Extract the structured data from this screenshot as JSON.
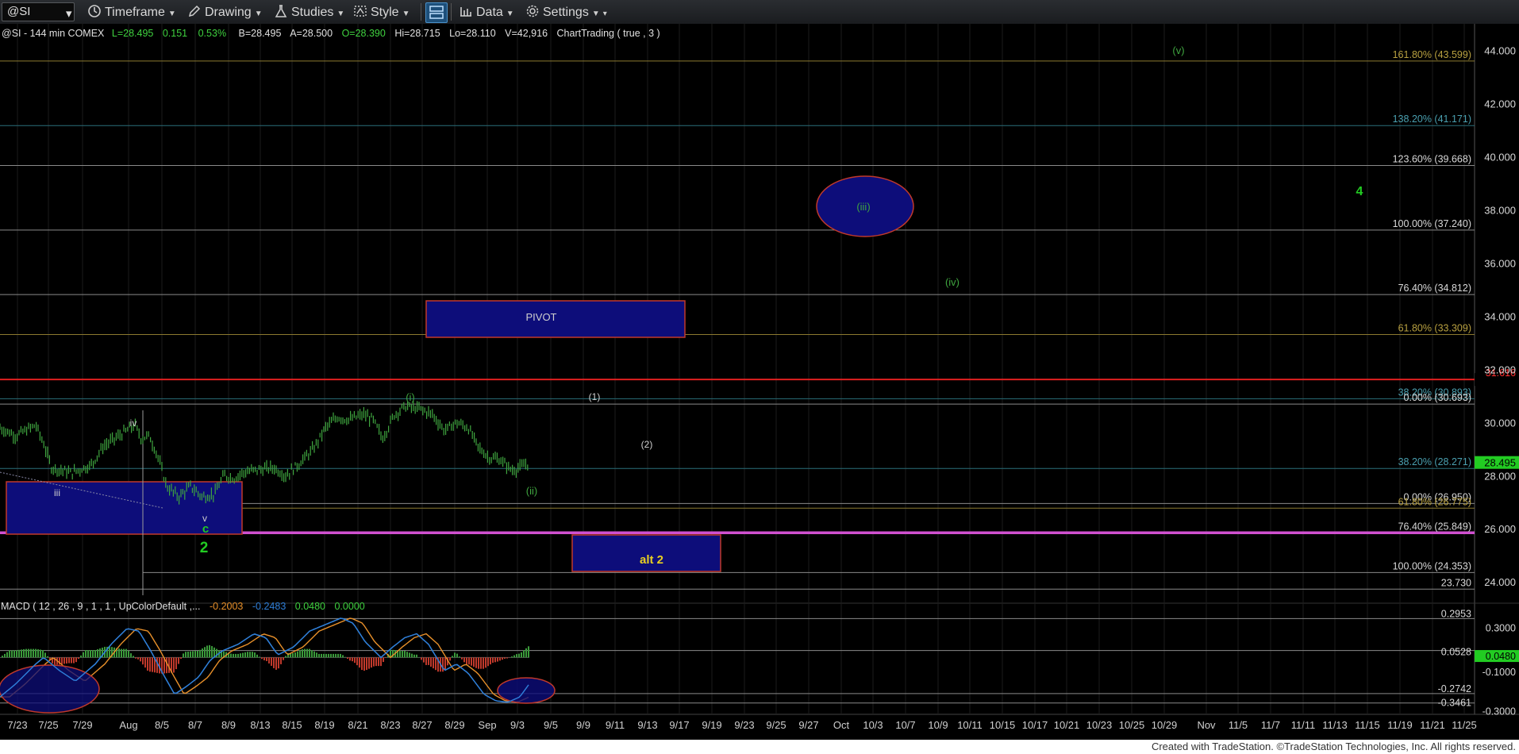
{
  "toolbar": {
    "symbol": "@SI",
    "timeframe": "Timeframe",
    "drawing": "Drawing",
    "studies": "Studies",
    "style": "Style",
    "data": "Data",
    "settings": "Settings"
  },
  "header": {
    "label": "@SI - 144 min  COMEX",
    "last": "L=28.495",
    "chg": "0.151",
    "pct": "0.53%",
    "bid": "B=28.495",
    "ask": "A=28.500",
    "open": "O=28.390",
    "hi": "Hi=28.715",
    "lo": "Lo=28.110",
    "vol": "V=42,916",
    "study": "ChartTrading ( true , 3 )"
  },
  "macd": {
    "label": "MACD ( 12 , 26 , 9 , 1 , 1 , UpColorDefault ,...",
    "v1": "-0.2003",
    "v2": "-0.2483",
    "v3": "0.0480",
    "v4": "0.0000"
  },
  "footer": "Created with TradeStation. ©TradeStation Technologies, Inc. All rights reserved.",
  "colors": {
    "price": "#3fa53f",
    "up": "#3a9a3a",
    "down": "#c0392b",
    "box": "#0d0d7a",
    "box_border": "#c0392b",
    "magenta": "#d050d0",
    "red_line": "#e02020",
    "macd_line": "#2f7fd8",
    "signal_line": "#e8902a"
  },
  "chart_data": {
    "type": "line",
    "series": [],
    "ylim": [
      23.2,
      45.0
    ],
    "yticks": [
      "44.000",
      "42.000",
      "40.000",
      "38.000",
      "36.000",
      "34.000",
      "32.000",
      "30.000",
      "28.000",
      "26.000",
      "24.000"
    ],
    "xticks": [
      "7/23",
      "7/25",
      "7/29",
      "Aug",
      "8/5",
      "8/7",
      "8/9",
      "8/13",
      "8/15",
      "8/19",
      "8/21",
      "8/23",
      "8/27",
      "8/29",
      "Sep",
      "9/3",
      "9/5",
      "9/9",
      "9/11",
      "9/13",
      "9/17",
      "9/19",
      "9/23",
      "9/25",
      "9/27",
      "Oct",
      "10/3",
      "10/7",
      "10/9",
      "10/11",
      "10/15",
      "10/17",
      "10/21",
      "10/23",
      "10/25",
      "10/29",
      "Nov",
      "11/5",
      "11/7",
      "11/11",
      "11/13",
      "11/15",
      "11/19",
      "11/21",
      "11/25"
    ],
    "last_price": "28.495",
    "fib_levels": [
      {
        "label": "161.80% (43.599)",
        "value": 43.599,
        "color": "#8c7a30"
      },
      {
        "label": "138.20% (41.171)",
        "value": 41.171,
        "color": "#2a6f7a"
      },
      {
        "label": "123.60% (39.668)",
        "value": 39.668,
        "color": "#8a8a8a"
      },
      {
        "label": "100.00% (37.240)",
        "value": 37.24,
        "color": "#8a8a8a"
      },
      {
        "label": "76.40% (34.812)",
        "value": 34.812,
        "color": "#8a8a8a"
      },
      {
        "label": "61.80% (33.309)",
        "value": 33.309,
        "color": "#8c7a30"
      },
      {
        "label": "31.616",
        "value": 31.616,
        "color": "#e02020"
      },
      {
        "label": "38.20% (30.893)",
        "value": 30.893,
        "color": "#2a6f7a"
      },
      {
        "label": "0.00% (30.693)",
        "value": 30.693,
        "color": "#8a8a8a"
      },
      {
        "label": "38.20% (28.271)",
        "value": 28.271,
        "color": "#2a6f7a"
      },
      {
        "label": "0.00% (26.950)",
        "value": 26.95,
        "color": "#8a8a8a"
      },
      {
        "label": "61.80% (26.775)",
        "value": 26.775,
        "color": "#8c7a30"
      },
      {
        "label": "76.40% (25.849)",
        "value": 25.849,
        "color": "#d050d0"
      },
      {
        "label": "100.00% (24.353)",
        "value": 24.353,
        "color": "#8a8a8a"
      },
      {
        "label": "23.730",
        "value": 23.73,
        "color": "#8a8a8a"
      }
    ],
    "waves": [
      {
        "label": "(v)",
        "color": "#3fa53f"
      },
      {
        "label": "(iii)",
        "color": "#3fa53f"
      },
      {
        "label": "4",
        "color": "#22cc22"
      },
      {
        "label": "(iv)",
        "color": "#3fa53f"
      },
      {
        "label": "PIVOT",
        "color": "#cfcfcf"
      },
      {
        "label": "(i)",
        "color": "#3fa53f"
      },
      {
        "label": "(1)",
        "color": "#cfcfcf"
      },
      {
        "label": "(2)",
        "color": "#cfcfcf"
      },
      {
        "label": "iv",
        "color": "#cfcfcf"
      },
      {
        "label": "iii",
        "color": "#cfcfcf"
      },
      {
        "label": "(ii)",
        "color": "#3fa53f"
      },
      {
        "label": "v",
        "color": "#cfcfcf"
      },
      {
        "label": "c",
        "color": "#22cc22"
      },
      {
        "label": "2",
        "color": "#22cc22"
      },
      {
        "label": "alt 2",
        "color": "#e8d020"
      }
    ],
    "macd_levels": [
      "0.2953",
      "0.3000",
      "0.0528",
      "0.0480",
      "-0.1000",
      "-0.2742",
      "-0.3461",
      "-0.3000"
    ],
    "macd_ylim": [
      -0.42,
      0.34
    ]
  }
}
